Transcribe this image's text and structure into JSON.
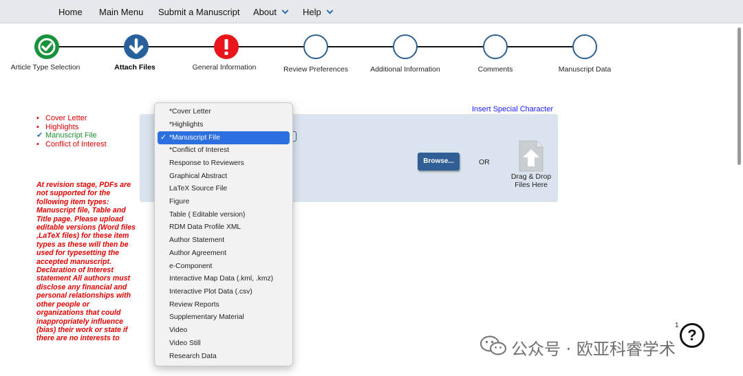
{
  "nav": {
    "home": "Home",
    "main_menu": "Main Menu",
    "submit": "Submit a Manuscript",
    "about": "About",
    "help": "Help"
  },
  "steps": [
    {
      "label": "Article Type Selection",
      "state": "done"
    },
    {
      "label": "Attach Files",
      "state": "current"
    },
    {
      "label": "General Information",
      "state": "error"
    },
    {
      "label": "Review Preferences",
      "state": "pending"
    },
    {
      "label": "Additional Information",
      "state": "pending"
    },
    {
      "label": "Comments",
      "state": "pending"
    },
    {
      "label": "Manuscript Data",
      "state": "pending"
    }
  ],
  "checklist": [
    {
      "label": "Cover Letter",
      "status": "missing"
    },
    {
      "label": "Highlights",
      "status": "missing"
    },
    {
      "label": "Manuscript File",
      "status": "done"
    },
    {
      "label": "Conflict of Interest",
      "status": "missing"
    }
  ],
  "warning_text": "At revision stage, PDFs are not supported for the following item types: Manuscript file, Table and Title page. Please upload editable versions (Word files ,LaTeX files) for these item types as these will then be used for typesetting the accepted manuscript. Declaration of Interest statement All authors must disclose any financial and personal relationships with other people or organizations that could inappropriately influence (bias) their work or state if there are no interests to",
  "insert_special_character": "Insert Special Character",
  "upload": {
    "browse_label": "Browse...",
    "or_label": "OR",
    "drop_label": "Drag & Drop Files Here"
  },
  "dropdown": {
    "selected": "*Manuscript File",
    "options": [
      "*Cover Letter",
      "*Highlights",
      "*Manuscript File",
      "*Conflict of Interest",
      "Response to Reviewers",
      "Graphical Abstract",
      "LaTeX Source File",
      "Figure",
      "Table ( Editable version)",
      "RDM Data Profile XML",
      "Author Statement",
      "Author Agreement",
      "e-Component",
      "Interactive Map Data (.kml, .kmz)",
      "Interactive Plot Data (.csv)",
      "Review Reports",
      "Supplementary Material",
      "Video",
      "Video Still",
      "Research Data"
    ]
  },
  "help": {
    "badge_count": "1",
    "icon_glyph": "?"
  },
  "watermark": "公众号 · 欧亚科睿学术",
  "colors": {
    "step_done": "#17923a",
    "step_current": "#27609a",
    "step_error": "#e8161b",
    "step_pending_border": "#2c5f8f",
    "warning_red": "#e00000",
    "selection_blue": "#2e6fe0",
    "link_blue": "#1a1aff"
  }
}
